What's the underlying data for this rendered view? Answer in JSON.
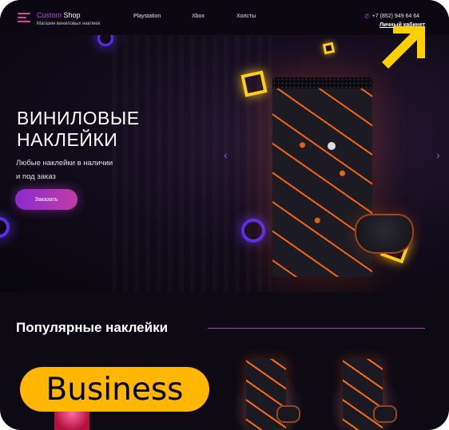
{
  "header": {
    "logo_brand": "Custom",
    "logo_shop": " Shop",
    "logo_subtitle": "Магазин виниловых наклеек",
    "nav": [
      "Playstation",
      "Xbox",
      "Холсты"
    ],
    "phone": "+7 (852) 949 64 64",
    "cabinet": "Личный кабинет"
  },
  "hero": {
    "title_line1": "ВИНИЛОВЫЕ",
    "title_line2": "НАКЛЕЙКИ",
    "subtitle_line1": "Любые наклейки в наличии",
    "subtitle_line2": "и под заказ",
    "order_button": "Заказать"
  },
  "popular": {
    "title": "Популярные наклейки"
  },
  "badge": "Business",
  "colors": {
    "accent": "#b24bd6",
    "button_gradient_start": "#8b2bd0",
    "button_gradient_end": "#c23ca6",
    "neon_yellow": "#ffd21a",
    "badge_yellow": "#ffb703",
    "lava_orange": "#ff6a14"
  },
  "icons": {
    "menu": "burger-menu-icon",
    "phone": "phone-icon",
    "prev": "chevron-left-icon",
    "next": "chevron-right-icon",
    "corner": "arrow-up-right-icon"
  }
}
